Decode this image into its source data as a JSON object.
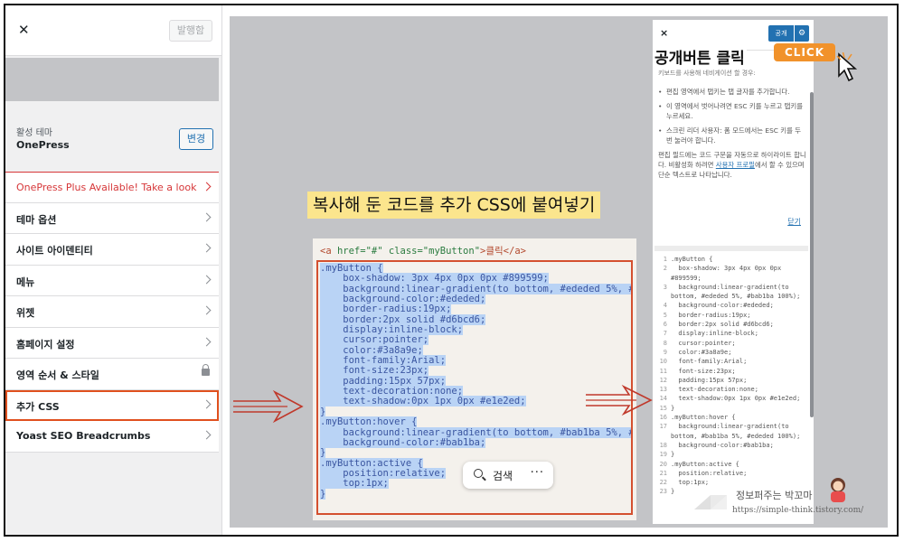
{
  "sidebar": {
    "close_icon": "close-icon",
    "publish_label": "발행함",
    "theme_label": "활성 테마",
    "theme_name": "OnePress",
    "theme_change_label": "변경",
    "items": [
      {
        "label": "OnePress Plus Available! Take a look"
      },
      {
        "label": "테마 옵션"
      },
      {
        "label": "사이트 아이덴티티"
      },
      {
        "label": "메뉴"
      },
      {
        "label": "위젯"
      },
      {
        "label": "홈페이지 설정"
      },
      {
        "label": "영역 순서 & 스타일"
      },
      {
        "label": "추가 CSS"
      },
      {
        "label": "Yoast SEO Breadcrumbs"
      }
    ]
  },
  "preview": {
    "headline": "복사해 둔 코드를 추가 CSS에 붙여넣기",
    "code_tag": {
      "open": "<a ",
      "href": "href=\"#\"",
      "cls": "class=\"myButton\"",
      "rest": ">클릭</a>"
    },
    "code_lines": [
      ".myButton {",
      "    box-shadow: 3px 4px 0px 0px #899599;",
      "    background:linear-gradient(to bottom, #ededed 5%, #",
      "    background-color:#ededed;",
      "    border-radius:19px;",
      "    border:2px solid #d6bcd6;",
      "    display:inline-block;",
      "    cursor:pointer;",
      "    color:#3a8a9e;",
      "    font-family:Arial;",
      "    font-size:23px;",
      "    padding:15px 57px;",
      "    text-decoration:none;",
      "    text-shadow:0px 1px 0px #e1e2ed;",
      "}",
      ".myButton:hover {",
      "    background:linear-gradient(to bottom, #bab1ba 5%, #",
      "    background-color:#bab1ba;",
      "}",
      ".myButton:active {",
      "    position:relative;",
      "    top:1px;",
      "}"
    ],
    "search_label": "검색",
    "more_label": "···"
  },
  "rpanel": {
    "close_label": "×",
    "publish_label": "공개",
    "gear_icon": "gear-icon",
    "headline": "공개버튼 클릭",
    "click_badge": "CLICK",
    "subline": "키보드를 사용해 네비게이션 할 경우:",
    "help_items": [
      "편집 영역에서 탭키는 탭 글자를 추가합니다.",
      "이 영역에서 벗어나려면 ESC 키를 누르고 탭키를 누르세요.",
      "스크린 리더 사용자: 폼 모드에서는 ESC 키를 두 번 눌러야 합니다."
    ],
    "help_para_a": "편집 필드에는 코드 구문을 자동으로 하이라이트 합니다. 비활성화 하려면 ",
    "help_link": "사용자 프로필",
    "help_para_b": "에서 할 수 있으며 단순 텍스트로 나타납니다.",
    "close_link": "닫기",
    "code_lines": [
      {
        "n": "1",
        "t": ".myButton {"
      },
      {
        "n": "2",
        "t": "  box-shadow: 3px 4px 0px 0px"
      },
      {
        "n": "",
        "t": "#899599;"
      },
      {
        "n": "3",
        "t": "  background:linear-gradient(to"
      },
      {
        "n": "",
        "t": "bottom, #ededed 5%, #bab1ba 100%);"
      },
      {
        "n": "4",
        "t": "  background-color:#ededed;"
      },
      {
        "n": "5",
        "t": "  border-radius:19px;"
      },
      {
        "n": "6",
        "t": "  border:2px solid #d6bcd6;"
      },
      {
        "n": "7",
        "t": "  display:inline-block;"
      },
      {
        "n": "8",
        "t": "  cursor:pointer;"
      },
      {
        "n": "9",
        "t": "  color:#3a8a9e;"
      },
      {
        "n": "10",
        "t": "  font-family:Arial;"
      },
      {
        "n": "11",
        "t": "  font-size:23px;"
      },
      {
        "n": "12",
        "t": "  padding:15px 57px;"
      },
      {
        "n": "13",
        "t": "  text-decoration:none;"
      },
      {
        "n": "14",
        "t": "  text-shadow:0px 1px 0px #e1e2ed;"
      },
      {
        "n": "15",
        "t": "}"
      },
      {
        "n": "16",
        "t": ".myButton:hover {"
      },
      {
        "n": "17",
        "t": "  background:linear-gradient(to"
      },
      {
        "n": "",
        "t": "bottom, #bab1ba 5%, #ededed 100%);"
      },
      {
        "n": "18",
        "t": "  background-color:#bab1ba;"
      },
      {
        "n": "19",
        "t": "}"
      },
      {
        "n": "20",
        "t": ".myButton:active {"
      },
      {
        "n": "21",
        "t": "  position:relative;"
      },
      {
        "n": "22",
        "t": "  top:1px;"
      },
      {
        "n": "23",
        "t": "}"
      }
    ]
  },
  "watermark": {
    "name": "정보퍼주는 박꼬마",
    "url": "https://simple-think.tistory.com/"
  },
  "colors": {
    "accent_red": "#e0501e",
    "wp_blue": "#2271b1",
    "highlight_yellow": "#fbe58d",
    "click_orange": "#f1922b"
  }
}
